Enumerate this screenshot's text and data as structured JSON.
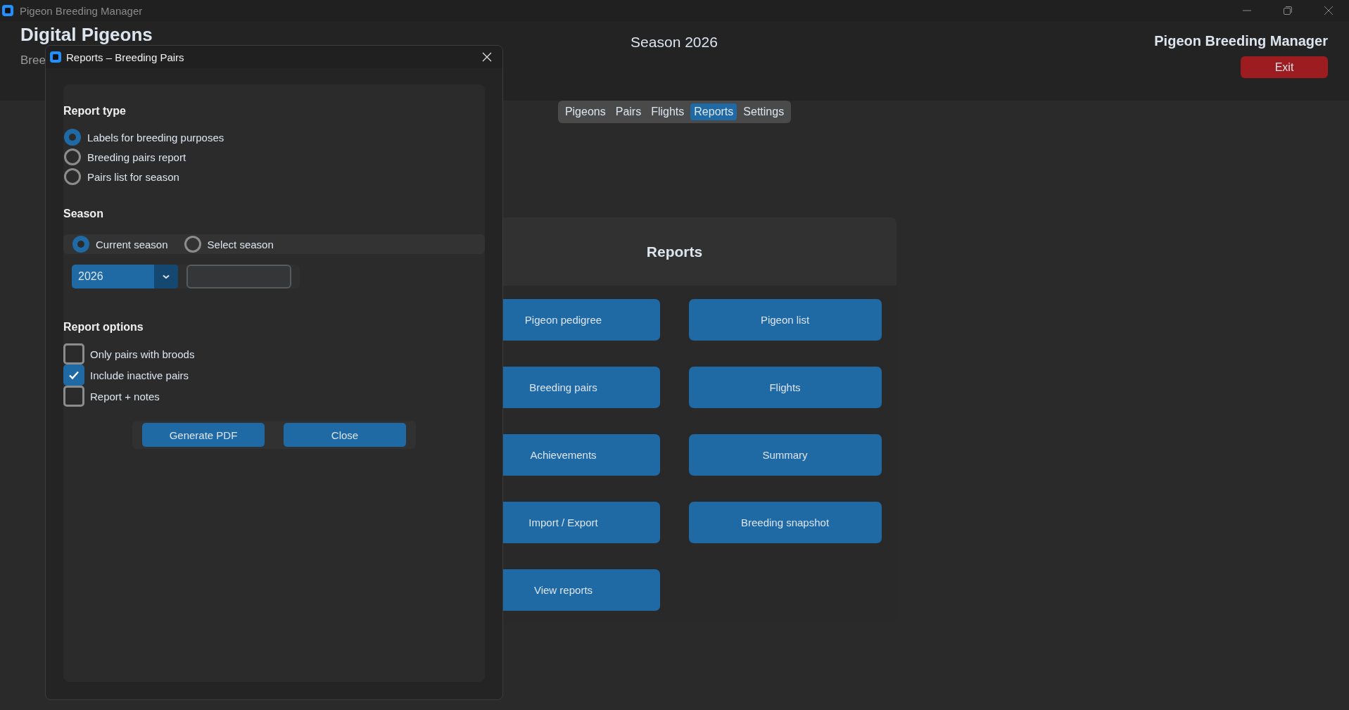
{
  "window": {
    "title": "Pigeon Breeding Manager"
  },
  "header": {
    "app_name": "Digital Pigeons",
    "subtitle": "Bree",
    "season": "Season 2026",
    "title": "Pigeon Breeding Manager",
    "exit_button": "Exit"
  },
  "tabs": [
    {
      "label": "Pigeons",
      "selected": false
    },
    {
      "label": "Pairs",
      "selected": false
    },
    {
      "label": "Flights",
      "selected": false
    },
    {
      "label": "Reports",
      "selected": true
    },
    {
      "label": "Settings",
      "selected": false
    }
  ],
  "reports_panel": {
    "title": "Reports",
    "buttons": [
      "Pigeon pedigree",
      "Pigeon list",
      "Breeding pairs",
      "Flights",
      "Achievements",
      "Summary",
      "Import / Export",
      "Breeding snapshot",
      "View reports"
    ]
  },
  "dialog": {
    "title": "Reports – Breeding Pairs",
    "report_type": {
      "heading": "Report type",
      "options": [
        {
          "label": "Labels for breeding purposes",
          "selected": true
        },
        {
          "label": "Breeding pairs report",
          "selected": false
        },
        {
          "label": "Pairs list for season",
          "selected": false
        }
      ]
    },
    "season": {
      "heading": "Season",
      "options": [
        {
          "label": "Current season",
          "selected": true
        },
        {
          "label": "Select season",
          "selected": false
        }
      ],
      "dropdown": {
        "value": "2026"
      }
    },
    "report_options": {
      "heading": "Report options",
      "options": [
        {
          "label": "Only pairs with broods",
          "checked": false
        },
        {
          "label": "Include inactive pairs",
          "checked": true
        },
        {
          "label": "Report + notes",
          "checked": false
        }
      ]
    },
    "buttons": [
      "Generate PDF",
      "Close"
    ]
  }
}
